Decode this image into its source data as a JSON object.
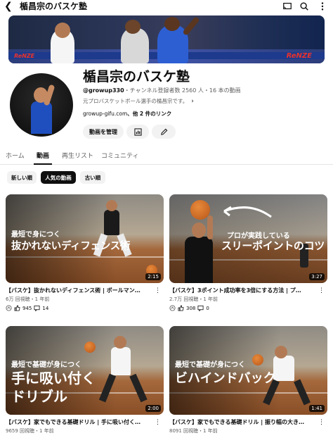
{
  "topbar": {
    "title": "楯昌宗のバスケ塾"
  },
  "banner": {
    "ad_right": "ReNZE",
    "ad_left": "ReNZE"
  },
  "channel": {
    "name": "楯昌宗のバスケ塾",
    "handle": "@growup330",
    "meta": "・チャンネル登録者数 2560 人・16 本の動画",
    "description": "元プロバスケットボール選手の楯昌宗です。",
    "link": "growup-gifu.com",
    "link_more": "、他 2 件のリンク",
    "manage_button": "動画を管理"
  },
  "tabs": [
    "ホーム",
    "動画",
    "再生リスト",
    "コミュニティ"
  ],
  "chips": [
    "新しい順",
    "人気の動画",
    "古い順"
  ],
  "videos": [
    {
      "thumb_line1": "最短で身につく",
      "thumb_line2": "抜かれないディフェンス術",
      "duration": "2:15",
      "title": "【バスケ】抜かれないディフェンス術 | ボールマン…",
      "meta": "6万 回視聴・1 年前",
      "likes": "945",
      "comments": "14"
    },
    {
      "thumb_line1": "プロが実践している",
      "thumb_line2": "スリーポイントのコツ",
      "duration": "3:27",
      "title": "【バスケ】3ポイント成功率を3倍にする方法 | プ…",
      "meta": "2.7万 回視聴・1 年前",
      "likes": "308",
      "comments": "0"
    },
    {
      "thumb_line1": "最短で基礎が身につく",
      "thumb_line2": "手に吸い付く",
      "thumb_line3": "ドリブル",
      "duration": "2:00",
      "title": "【バスケ】家でもできる基礎ドリル | 手に吸い付く…",
      "meta": "9659 回視聴・1 年前"
    },
    {
      "thumb_line1": "最短で基礎が身につく",
      "thumb_line2": "ビハインドバック",
      "duration": "1:41",
      "title": "【バスケ】家でもできる基礎ドリル | 振り幅の大き…",
      "meta": "8091 回視聴・1 年前"
    }
  ],
  "colors": {
    "accent_text": "#0f0f0f",
    "secondary_text": "#606060",
    "chip_bg": "#f2f2f2"
  }
}
